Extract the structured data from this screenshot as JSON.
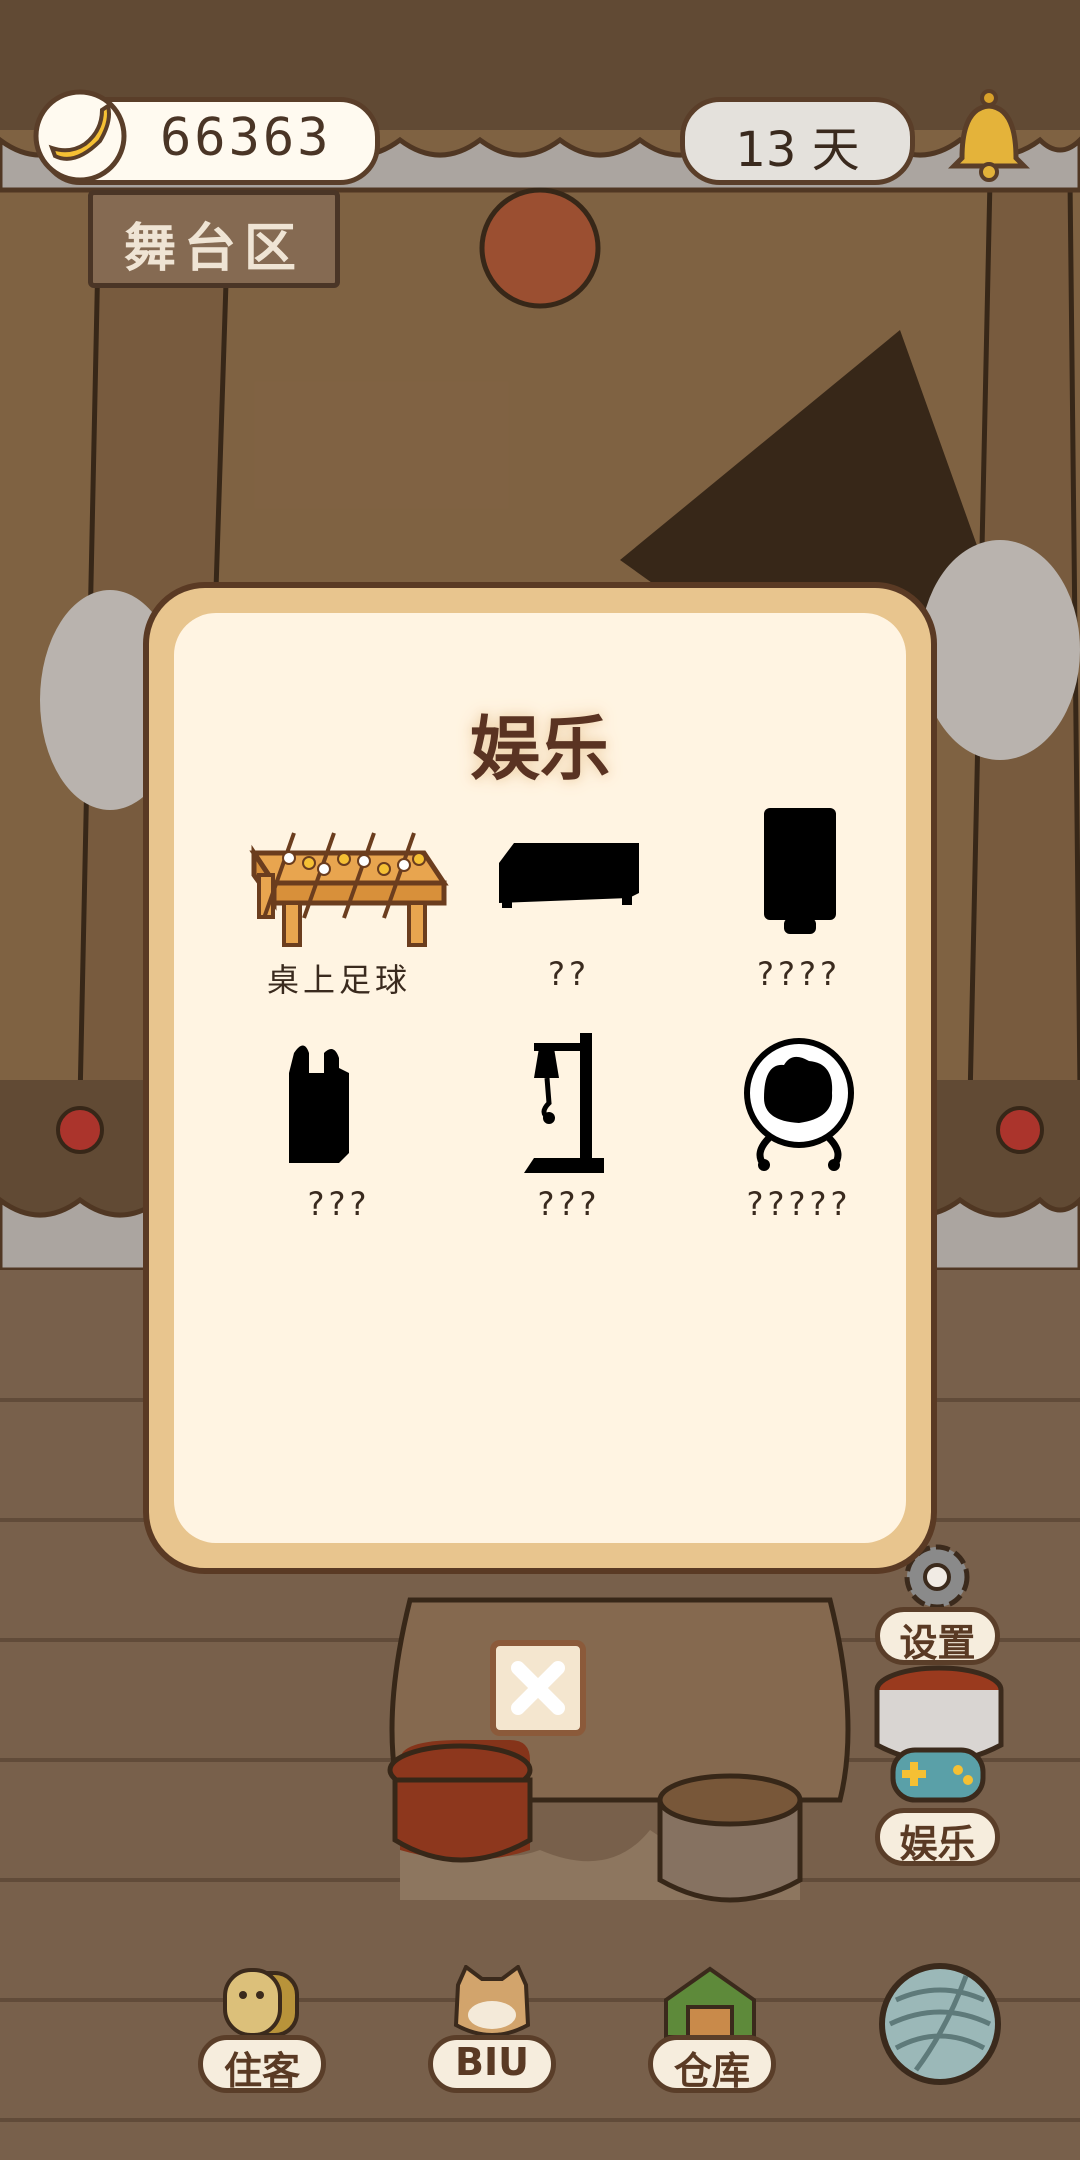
{
  "top_bar": {
    "coins": "66363",
    "days": "13 天",
    "area_sign": "舞台区",
    "coin_icon": "banana-icon",
    "bell_icon": "bell-icon"
  },
  "modal": {
    "title": "娱乐",
    "items": [
      {
        "label": "桌上足球",
        "icon": "foosball-table-icon",
        "unlocked": true
      },
      {
        "label": "??",
        "icon": "locked-item-silhouette-icon",
        "unlocked": false
      },
      {
        "label": "????",
        "icon": "locked-item-silhouette-icon",
        "unlocked": false
      },
      {
        "label": "???",
        "icon": "locked-item-silhouette-icon",
        "unlocked": false
      },
      {
        "label": "???",
        "icon": "locked-item-silhouette-icon",
        "unlocked": false
      },
      {
        "label": "?????",
        "icon": "locked-item-silhouette-icon",
        "unlocked": false
      }
    ],
    "close_icon": "close-icon"
  },
  "side_menu": {
    "settings_label": "设置",
    "entertainment_label": "娱乐"
  },
  "bottom_nav": {
    "residents_label": "住客",
    "biu_label": "BIU",
    "warehouse_label": "仓库",
    "yarn_icon": "yarn-ball-icon"
  },
  "colors": {
    "modal_border": "#5a3a24",
    "modal_frame": "#e8c58e",
    "modal_inner": "#fff4e2",
    "text_dark": "#3a2a1e"
  }
}
